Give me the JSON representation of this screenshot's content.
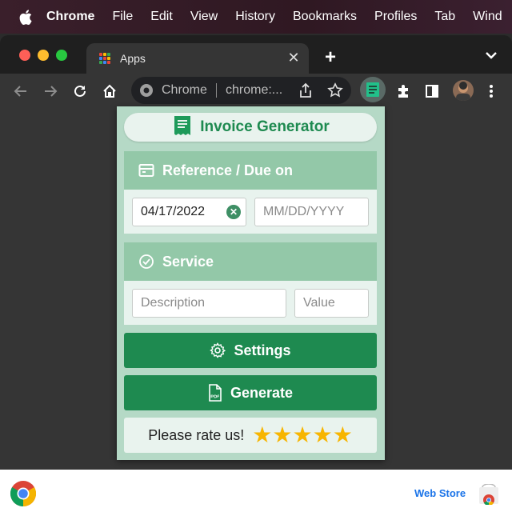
{
  "menubar": {
    "app_name": "Chrome",
    "items": [
      "File",
      "Edit",
      "View",
      "History",
      "Bookmarks",
      "Profiles",
      "Tab",
      "Wind"
    ]
  },
  "browser": {
    "tab_title": "Apps",
    "omnibox_chip": "Chrome",
    "omnibox_url": "chrome:..."
  },
  "popup": {
    "brand": "Invoice Generator",
    "reference_section": {
      "title": "Reference / Due on",
      "reference_value": "04/17/2022",
      "due_placeholder": "MM/DD/YYYY"
    },
    "service_section": {
      "title": "Service",
      "description_placeholder": "Description",
      "value_placeholder": "Value"
    },
    "settings_label": "Settings",
    "generate_label": "Generate",
    "rate_label": "Please rate us!",
    "rating_stars": 5
  },
  "bottombar": {
    "web_store_label": "Web Store"
  },
  "colors": {
    "brand_green": "#1e8a50",
    "section_header": "#93c8a8",
    "popup_bg": "#b5d9c6",
    "star": "#f7b500"
  }
}
